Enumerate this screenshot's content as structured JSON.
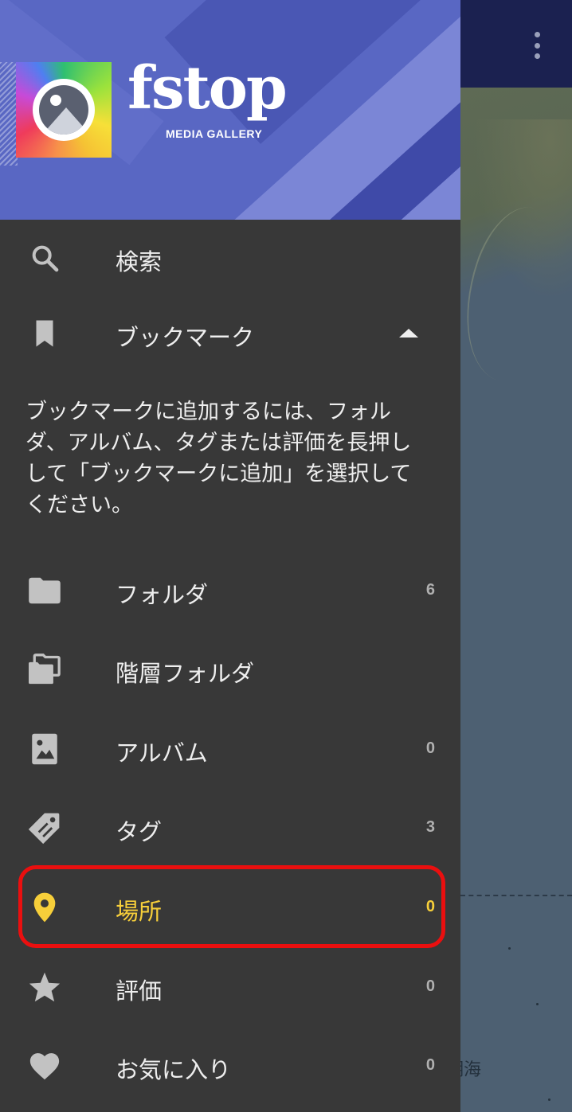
{
  "brand": {
    "wordmark": "fstop",
    "tagline": "MEDIA GALLERY"
  },
  "drawer": {
    "search": {
      "label": "検索",
      "icon": "search-icon"
    },
    "bookmarks": {
      "label": "ブックマーク",
      "icon": "bookmark-icon",
      "expanded": true,
      "hint": "ブックマークに追加するには、フォルダ、アルバム、タグまたは評価を長押しして「ブックマークに追加」を選択してください。"
    },
    "items": [
      {
        "id": "folders",
        "label": "フォルダ",
        "count": "6",
        "icon": "folder-icon"
      },
      {
        "id": "nested-folders",
        "label": "階層フォルダ",
        "count": "",
        "icon": "nested-folder-icon"
      },
      {
        "id": "albums",
        "label": "アルバム",
        "count": "0",
        "icon": "image-icon"
      },
      {
        "id": "tags",
        "label": "タグ",
        "count": "3",
        "icon": "tag-icon"
      },
      {
        "id": "places",
        "label": "場所",
        "count": "0",
        "icon": "location-pin-icon",
        "active": true
      },
      {
        "id": "ratings",
        "label": "評価",
        "count": "0",
        "icon": "star-icon"
      },
      {
        "id": "favorites",
        "label": "お気に入り",
        "count": "0",
        "icon": "heart-icon"
      }
    ]
  },
  "map": {
    "sea_label": "湖海"
  },
  "colors": {
    "drawer_bg": "#383838",
    "header_bg": "#5967c3",
    "active": "#f7cf3a",
    "highlight_border": "#ea0f0f",
    "map_topbar": "#1b2150"
  }
}
